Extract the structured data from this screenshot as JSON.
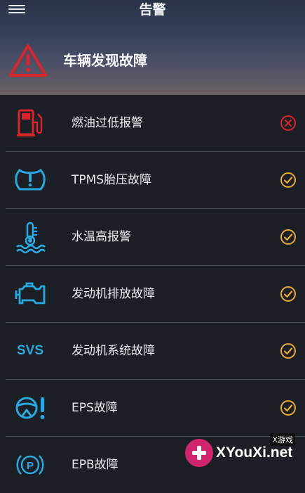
{
  "header": {
    "title": "告警",
    "alert_text": "车辆发现故障"
  },
  "items": [
    {
      "label": "燃油过低报警",
      "icon": "fuel-icon",
      "status": "error"
    },
    {
      "label": "TPMS胎压故障",
      "icon": "tire-pressure-icon",
      "status": "ok"
    },
    {
      "label": "水温高报警",
      "icon": "coolant-temperature-icon",
      "status": "ok"
    },
    {
      "label": "发动机排放故障",
      "icon": "engine-icon",
      "status": "ok"
    },
    {
      "label": "发动机系统故障",
      "icon": "svs-icon",
      "icon_text": "SVS",
      "status": "ok"
    },
    {
      "label": "EPS故障",
      "icon": "steering-warning-icon",
      "status": "ok"
    },
    {
      "label": "EPB故障",
      "icon": "parking-brake-icon",
      "status": "ok"
    }
  ],
  "watermark": {
    "text": "XYouXi.net",
    "tag": "X游戏"
  },
  "colors": {
    "error": "#d8242a",
    "ok": "#e8a93a",
    "icon_blue": "#2aa8e0"
  }
}
